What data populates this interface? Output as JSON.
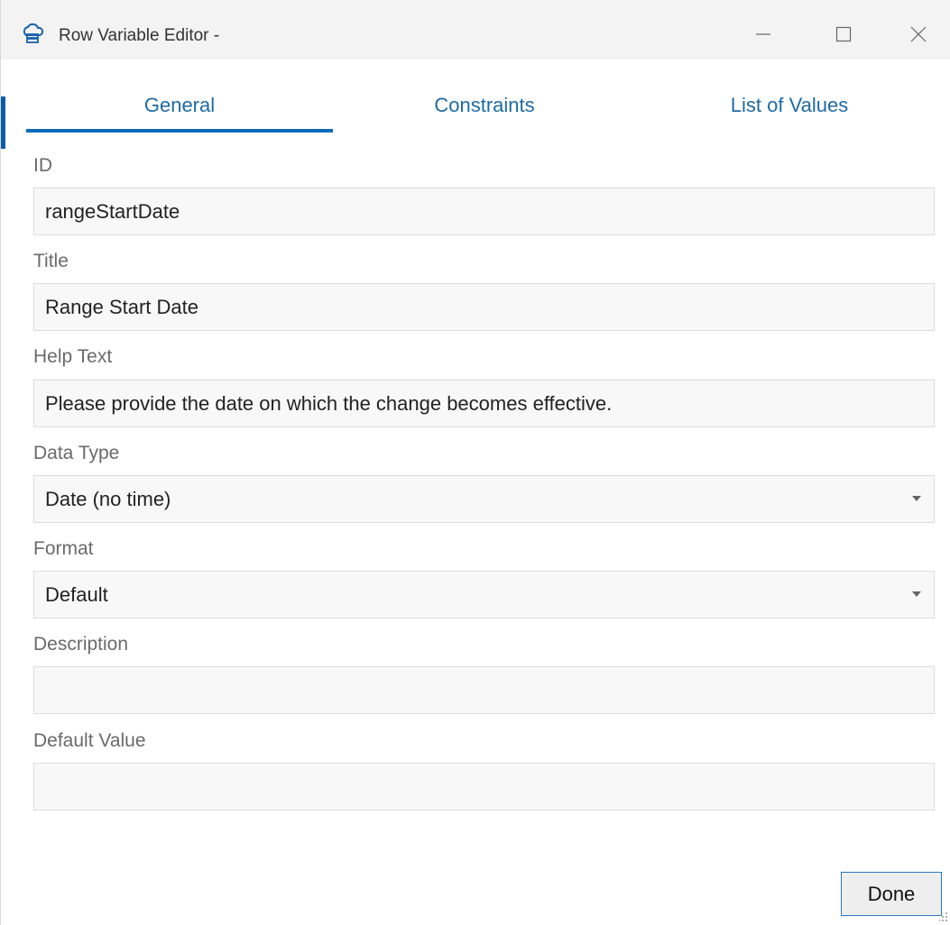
{
  "window": {
    "title": "Row Variable Editor -",
    "icon": "cloud-stack-icon"
  },
  "window_controls": [
    "minimize-icon",
    "maximize-icon",
    "close-icon"
  ],
  "tabs": [
    {
      "label": "General",
      "selected": true
    },
    {
      "label": "Constraints",
      "selected": false
    },
    {
      "label": "List of Values",
      "selected": false
    }
  ],
  "fields": {
    "id": {
      "label": "ID",
      "value": "rangeStartDate"
    },
    "title": {
      "label": "Title",
      "value": "Range Start Date"
    },
    "help_text": {
      "label": "Help Text",
      "value": "Please provide the date on which the change becomes effective."
    },
    "data_type": {
      "label": "Data Type",
      "value": "Date (no time)"
    },
    "format": {
      "label": "Format",
      "value": "Default"
    },
    "description": {
      "label": "Description",
      "value": ""
    },
    "default_value": {
      "label": "Default Value",
      "value": ""
    }
  },
  "footer": {
    "done_label": "Done"
  },
  "colors": {
    "accent": "#0a6bb8",
    "tab_text": "#1f6aa5",
    "label_text": "#6a6a6a",
    "field_bg": "#f8f8f8",
    "field_border": "#dcdcdc"
  }
}
